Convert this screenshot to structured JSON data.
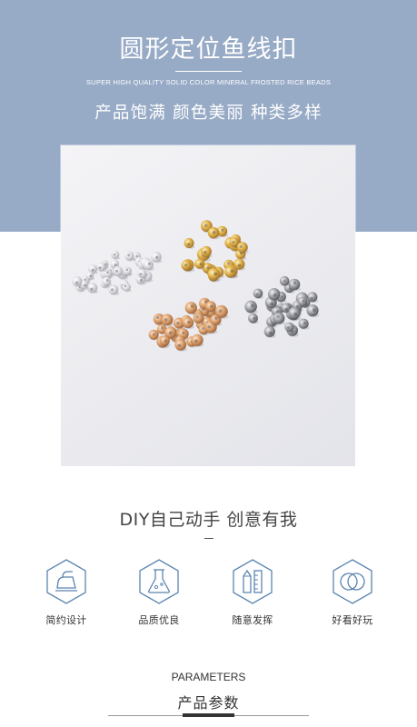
{
  "hero": {
    "title": "圆形定位鱼线扣",
    "subtitle_en": "SUPER HIGH QUALITY SOLID COLOR MINERAL FROSTED RICE BEADS",
    "subtitle_cn": "产品饱满 颜色美丽 种类多样"
  },
  "photo": {
    "bead_colors": [
      "silver",
      "gold",
      "rose-gold",
      "steel-gray"
    ],
    "background_color": "#ecebef"
  },
  "slogan": "DIY自己动手 创意有我",
  "features": [
    {
      "icon": "iron-icon",
      "label": "简约设计"
    },
    {
      "icon": "flask-icon",
      "label": "品质优良"
    },
    {
      "icon": "pencil-ruler-icon",
      "label": "随意发挥"
    },
    {
      "icon": "rings-icon",
      "label": "好看好玩"
    }
  ],
  "parameters": {
    "title_en": "PARAMETERS",
    "title_cn": "产品参数"
  },
  "colors": {
    "hero_bg": "#97aac6",
    "icon_stroke": "#5b85b0",
    "text": "#333333"
  }
}
